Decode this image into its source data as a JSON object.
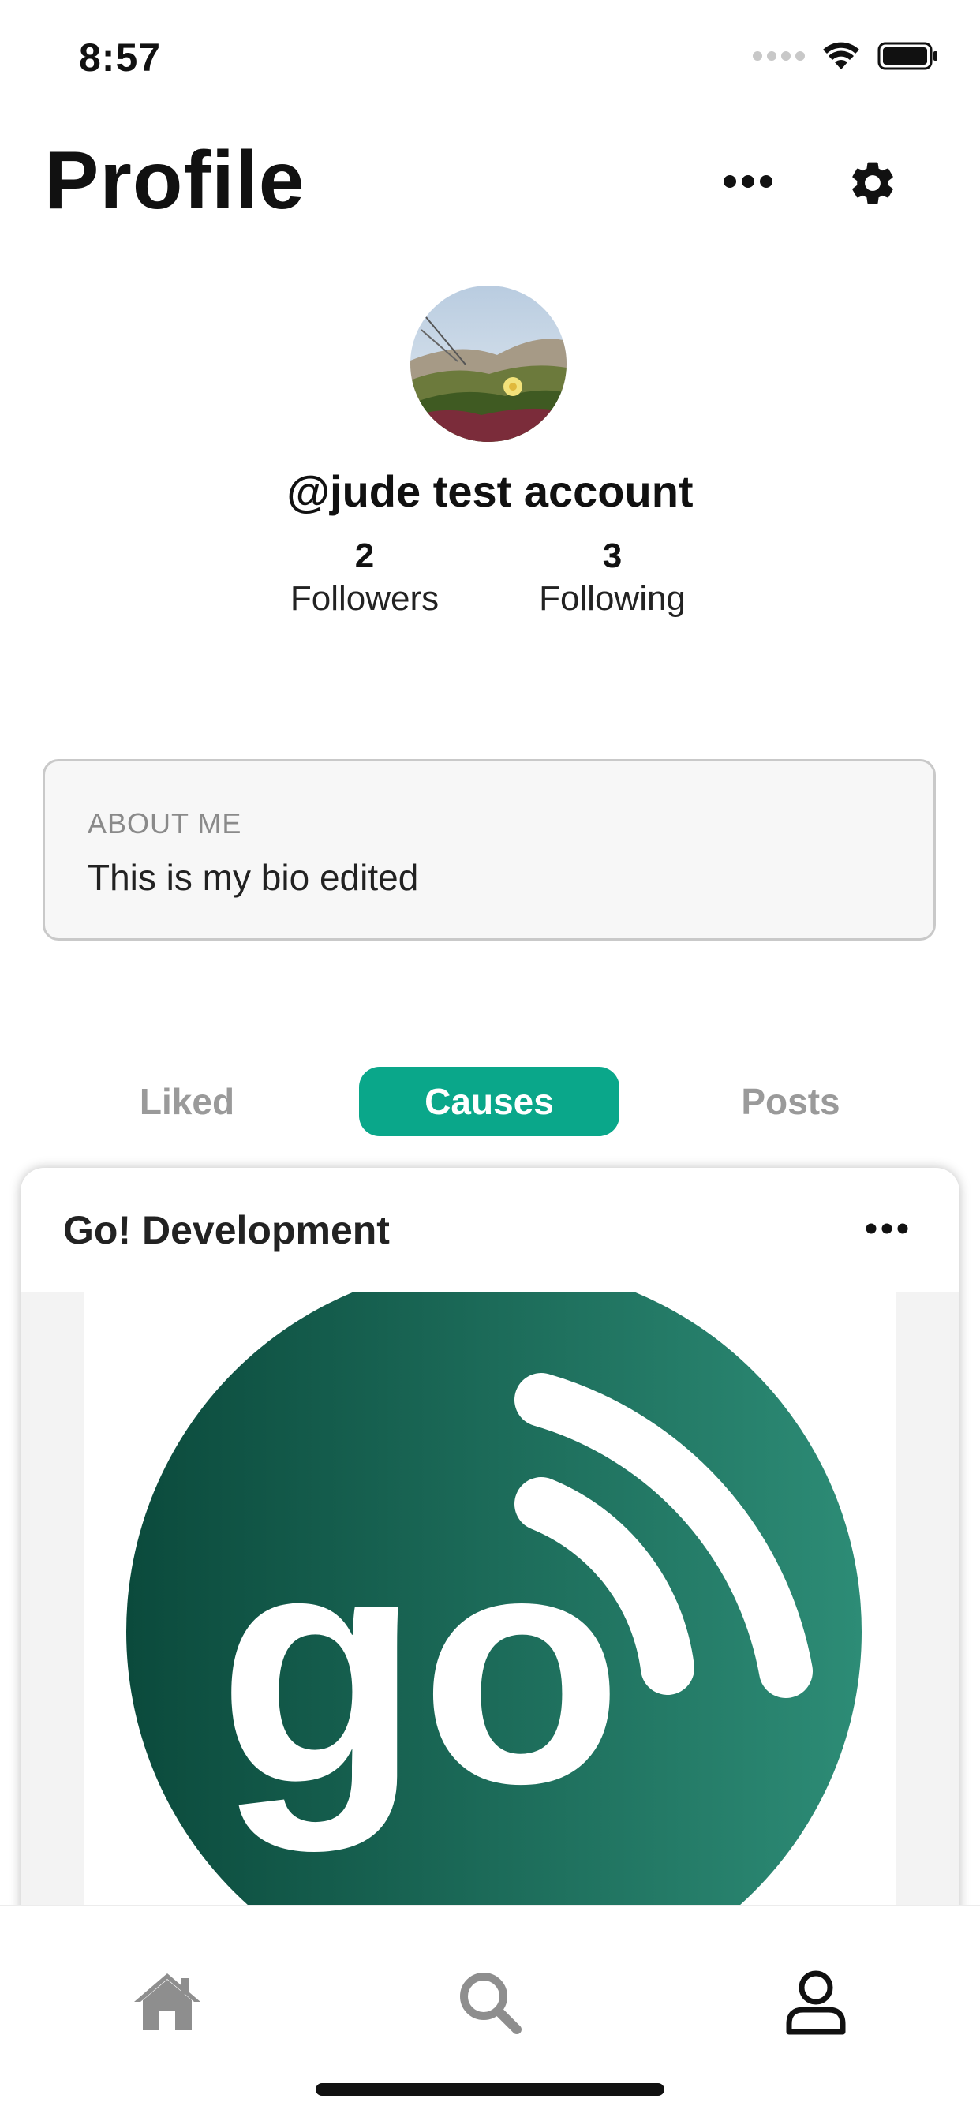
{
  "status_bar": {
    "time": "8:57"
  },
  "header": {
    "title": "Profile",
    "more_icon": "ellipsis-icon",
    "settings_icon": "gear-icon"
  },
  "profile": {
    "username": "@jude test account",
    "followers_count": "2",
    "followers_label": "Followers",
    "following_count": "3",
    "following_label": "Following"
  },
  "about": {
    "heading": "ABOUT ME",
    "text": "This is my bio edited"
  },
  "tabs": [
    {
      "label": "Liked",
      "active": false
    },
    {
      "label": "Causes",
      "active": true
    },
    {
      "label": "Posts",
      "active": false
    }
  ],
  "colors": {
    "accent": "#0aa78a",
    "logo_dark": "#0b4a3c",
    "logo_light": "#2d8c76"
  },
  "card": {
    "title": "Go! Development",
    "logo_text": "go"
  },
  "bottom_nav": [
    {
      "name": "home",
      "icon": "home-icon",
      "active": false
    },
    {
      "name": "search",
      "icon": "search-icon",
      "active": false
    },
    {
      "name": "profile",
      "icon": "user-icon",
      "active": true
    }
  ]
}
